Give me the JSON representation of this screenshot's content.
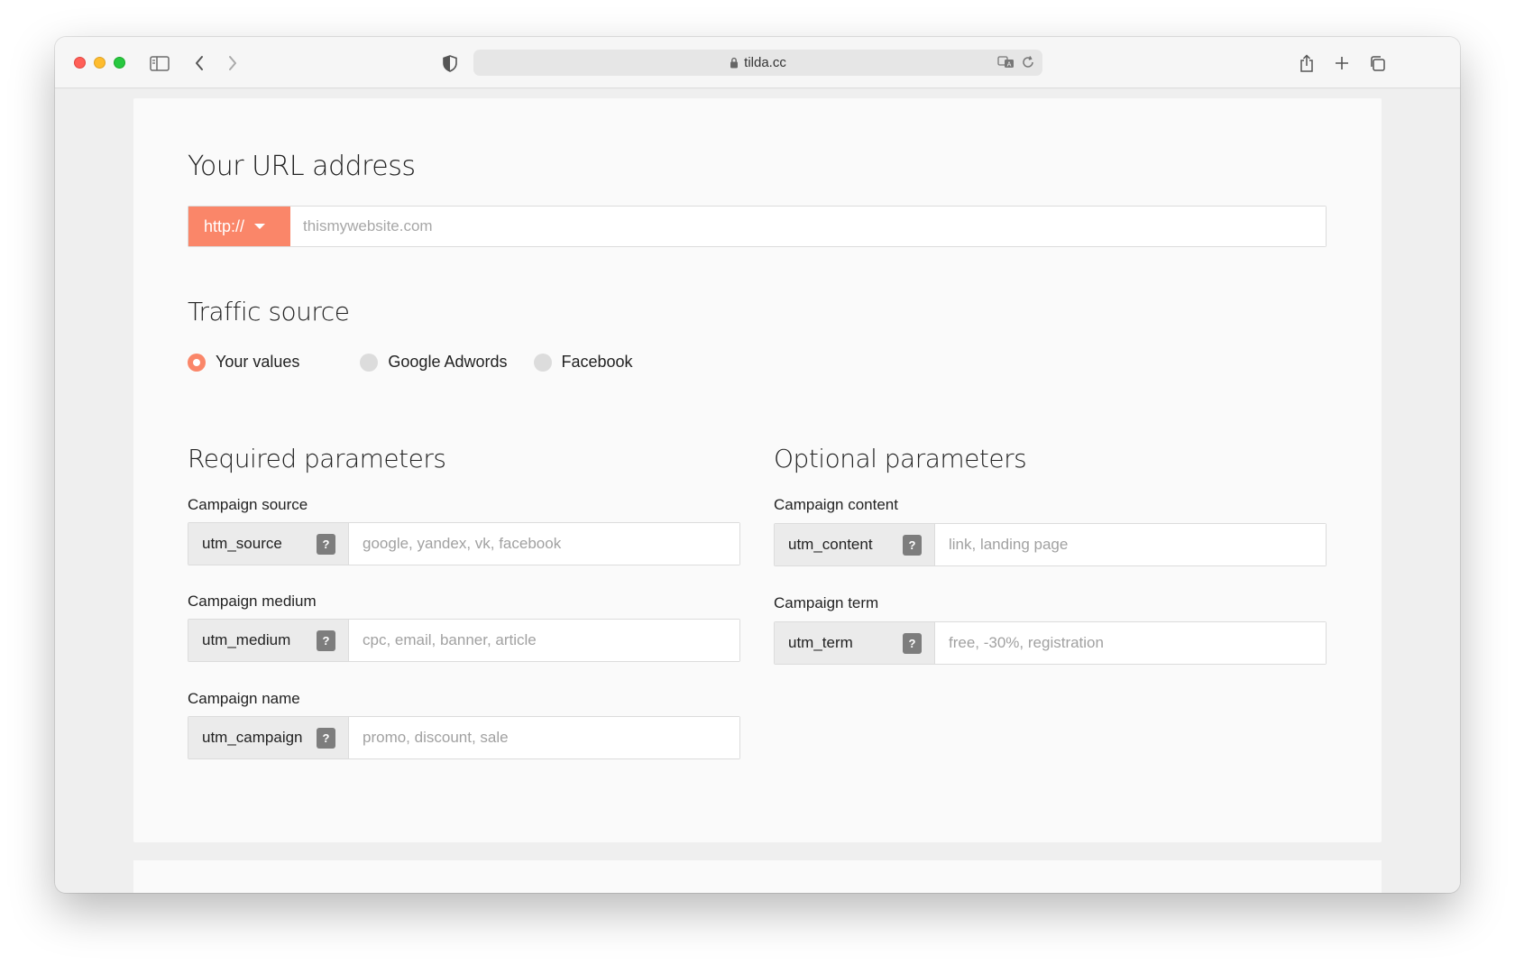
{
  "browser": {
    "address": "tilda.cc"
  },
  "url_section": {
    "title": "Your URL address",
    "protocol": "http://",
    "placeholder": "thismywebsite.com"
  },
  "traffic": {
    "title": "Traffic source",
    "options": [
      {
        "label": "Your values",
        "checked": true
      },
      {
        "label": "Google Adwords",
        "checked": false
      },
      {
        "label": "Facebook",
        "checked": false
      }
    ]
  },
  "required": {
    "title": "Required parameters",
    "fields": [
      {
        "label": "Campaign source",
        "key": "utm_source",
        "placeholder": "google, yandex, vk, facebook"
      },
      {
        "label": "Campaign medium",
        "key": "utm_medium",
        "placeholder": "cpc, email, banner, article"
      },
      {
        "label": "Campaign name",
        "key": "utm_campaign",
        "placeholder": "promo, discount, sale"
      }
    ]
  },
  "optional": {
    "title": "Optional parameters",
    "fields": [
      {
        "label": "Campaign content",
        "key": "utm_content",
        "placeholder": "link, landing page"
      },
      {
        "label": "Campaign term",
        "key": "utm_term",
        "placeholder": "free, -30%, registration"
      }
    ]
  },
  "help_glyph": "?",
  "colors": {
    "accent": "#fa8669",
    "help_badge": "#7d7d7d"
  }
}
